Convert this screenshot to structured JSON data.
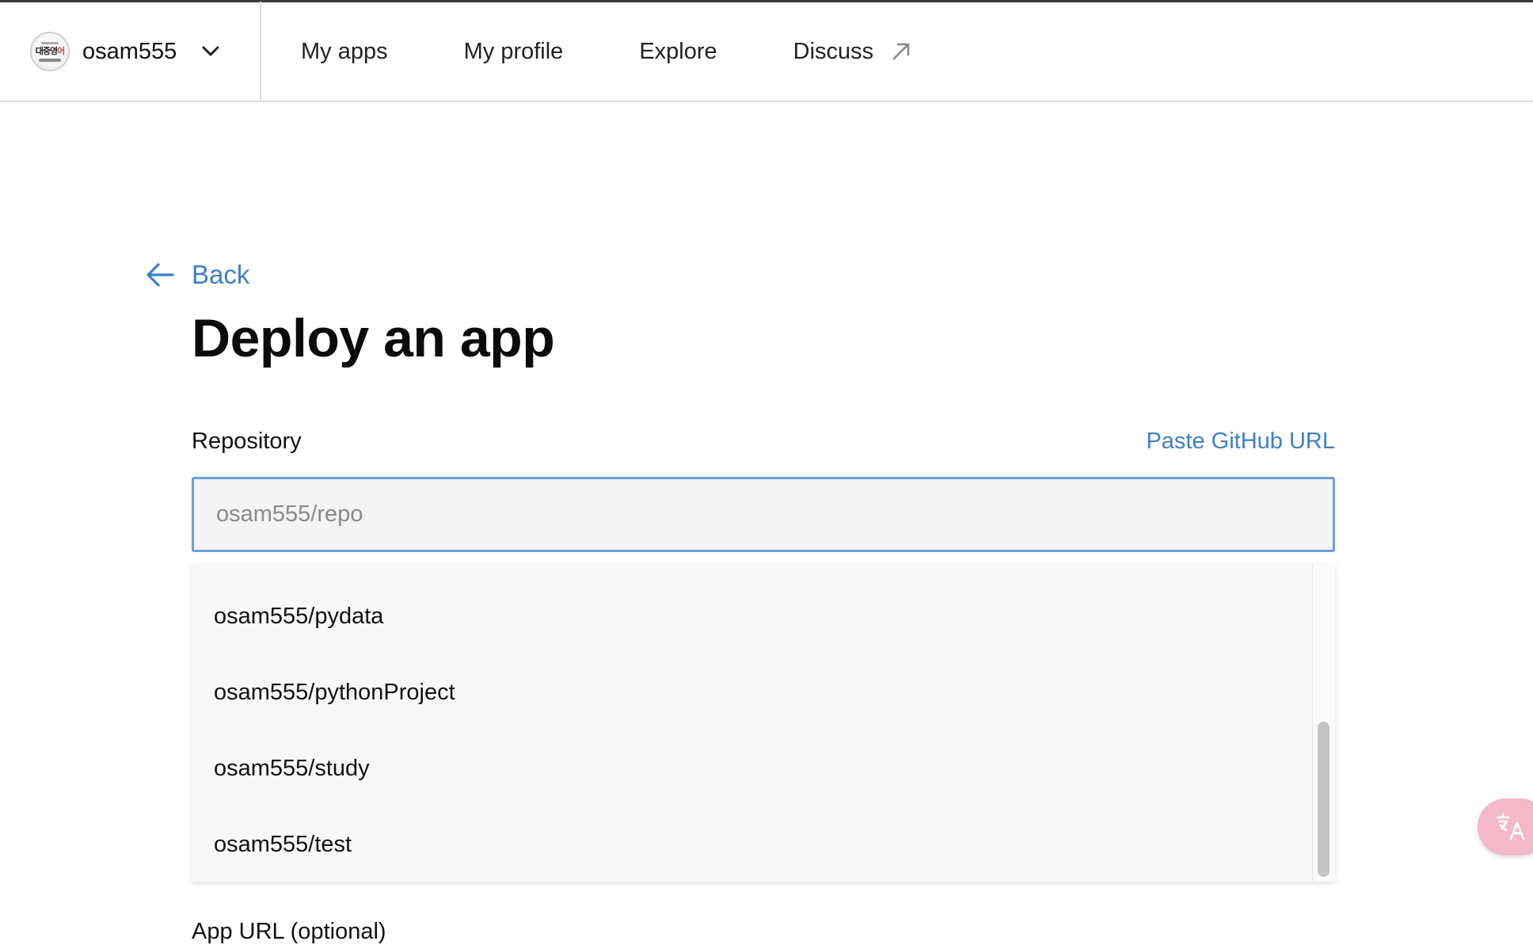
{
  "header": {
    "account_name": "osam555",
    "avatar_text_a": "대중영",
    "avatar_text_b": "어",
    "nav": [
      {
        "label": "My apps"
      },
      {
        "label": "My profile"
      },
      {
        "label": "Explore"
      },
      {
        "label": "Discuss"
      }
    ]
  },
  "page": {
    "back_label": "Back",
    "title": "Deploy an app",
    "repository_label": "Repository",
    "paste_link": "Paste GitHub URL",
    "repository_placeholder": "osam555/repo",
    "repository_value": "",
    "suggestions": [
      "osam555/pydata",
      "osam555/pythonProject",
      "osam555/study",
      "osam555/test"
    ],
    "app_url_label": "App URL (optional)"
  },
  "colors": {
    "accent": "#3f7fc7",
    "input_focus_border": "#6b9fd8",
    "translate_fab": "#f3b8c9"
  },
  "icons": {
    "account_chevron": "chevron-down-icon",
    "external": "external-link-icon",
    "back": "arrow-left-icon",
    "translate": "translate-icon"
  }
}
